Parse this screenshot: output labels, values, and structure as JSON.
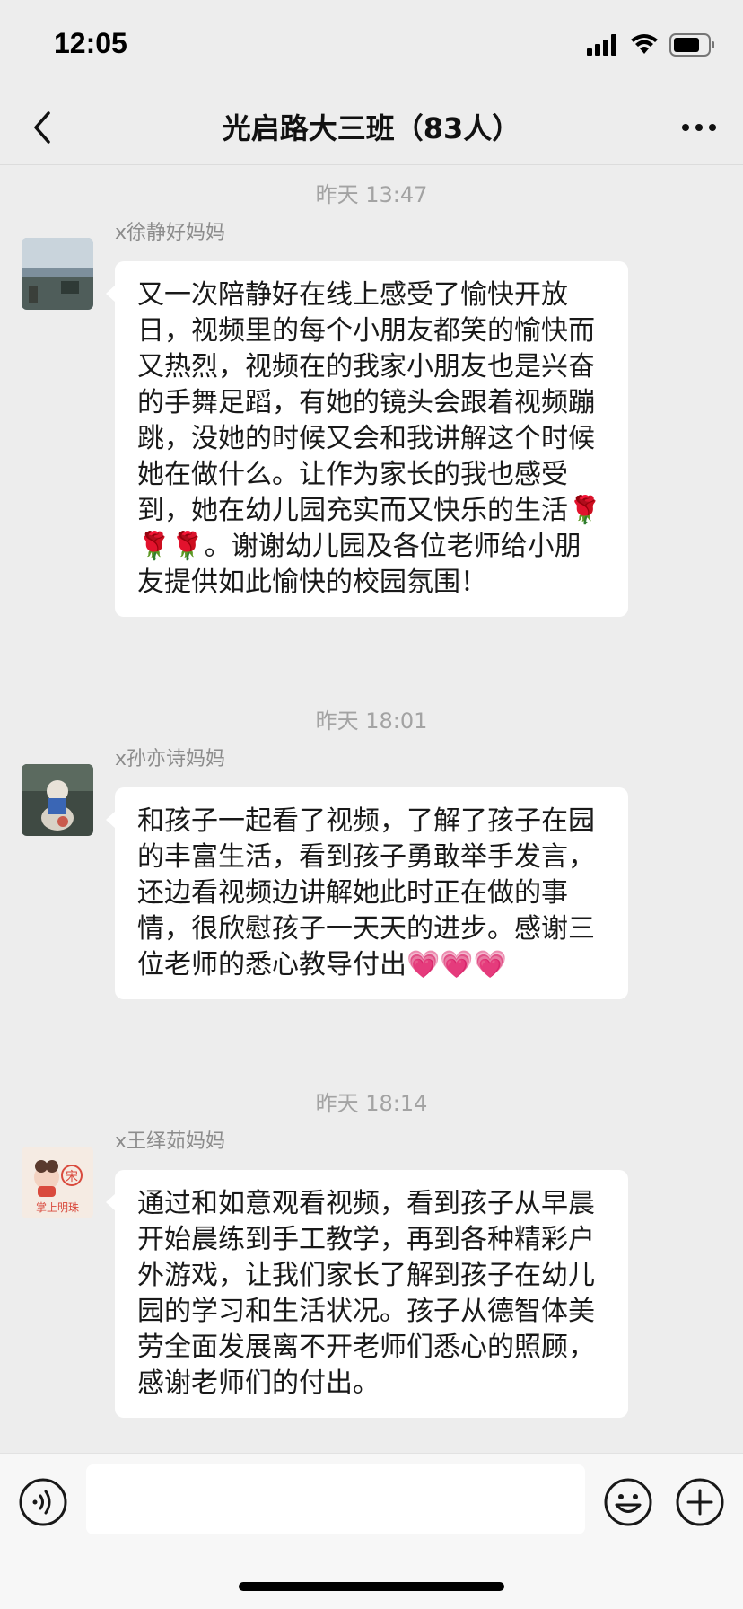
{
  "status": {
    "time": "12:05"
  },
  "nav": {
    "title": "光启路大三班（83人）"
  },
  "messages": [
    {
      "time": "昨天 13:47",
      "sender": "x徐静好妈妈",
      "text": "又一次陪静好在线上感受了愉快开放日，视频里的每个小朋友都笑的愉快而又热烈，视频在的我家小朋友也是兴奋的手舞足蹈，有她的镜头会跟着视频蹦跳，没她的时候又会和我讲解这个时候她在做什么。让作为家长的我也感受到，她在幼儿园充实而又快乐的生活🌹🌹🌹。谢谢幼儿园及各位老师给小朋友提供如此愉快的校园氛围！"
    },
    {
      "time": "昨天 18:01",
      "sender": "x孙亦诗妈妈",
      "text": "和孩子一起看了视频，了解了孩子在园的丰富生活，看到孩子勇敢举手发言，还边看视频边讲解她此时正在做的事情，很欣慰孩子一天天的进步。感谢三位老师的悉心教导付出💗💗💗"
    },
    {
      "time": "昨天 18:14",
      "sender": "x王绎茹妈妈",
      "text": "通过和如意观看视频，看到孩子从早晨开始晨练到手工教学，再到各种精彩户外游戏，让我们家长了解到孩子在幼儿园的学习和生活状况。孩子从德智体美劳全面发展离不开老师们悉心的照顾，感谢老师们的付出。"
    }
  ],
  "avatar3": {
    "top_char": "宋",
    "bottom_text": "掌上明珠"
  },
  "input": {
    "value": ""
  },
  "icons": {
    "back": "chevron-left-icon",
    "more": "more-dots-icon",
    "voice": "voice-icon",
    "emoji": "emoji-icon",
    "plus": "plus-icon"
  }
}
